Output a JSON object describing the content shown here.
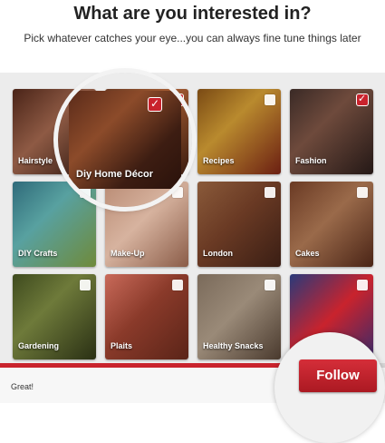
{
  "header": {
    "title": "What are you interested in?",
    "subtitle": "Pick whatever catches your eye...you can always fine tune things later"
  },
  "categories": [
    {
      "label": "Hairstyle",
      "selected": false
    },
    {
      "label": "Diy Home Décor",
      "selected": true
    },
    {
      "label": "Recipes",
      "selected": false
    },
    {
      "label": "Fashion",
      "selected": true
    },
    {
      "label": "DIY Crafts",
      "selected": false
    },
    {
      "label": "Make-Up",
      "selected": false
    },
    {
      "label": "London",
      "selected": false
    },
    {
      "label": "Cakes",
      "selected": false
    },
    {
      "label": "Gardening",
      "selected": false
    },
    {
      "label": "Plaits",
      "selected": false
    },
    {
      "label": "Healthy Snacks",
      "selected": false
    },
    {
      "label": "",
      "selected": false
    }
  ],
  "progress": {
    "fraction": 0.78
  },
  "footer": {
    "status_text": "Great!",
    "follow_label": "Follow"
  },
  "colors": {
    "accent": "#c9232d"
  }
}
